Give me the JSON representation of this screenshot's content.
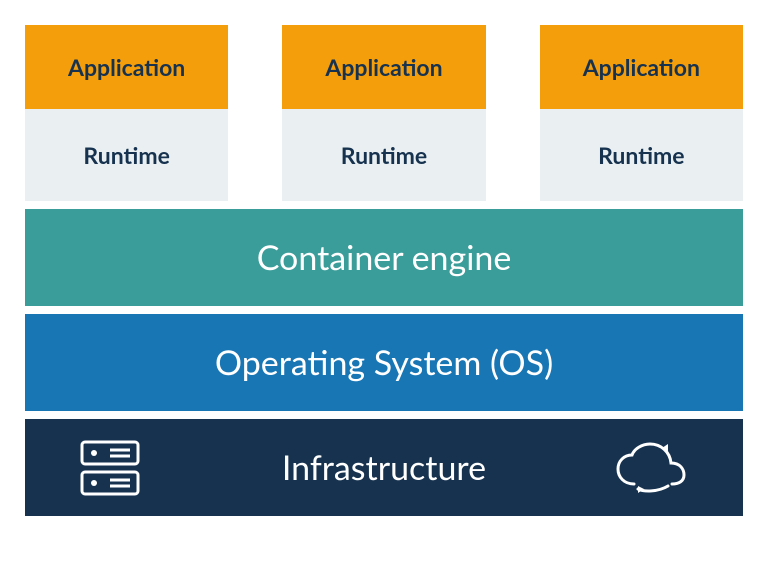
{
  "columns": [
    {
      "app": "Application",
      "runtime": "Runtime"
    },
    {
      "app": "Application",
      "runtime": "Runtime"
    },
    {
      "app": "Application",
      "runtime": "Runtime"
    }
  ],
  "layers": {
    "container_engine": "Container engine",
    "os": "Operating System (OS)",
    "infrastructure": "Infrastructure"
  },
  "colors": {
    "application": "#f59e0b",
    "runtime_bg": "#eaf0f2",
    "container_engine": "#3a9d9a",
    "os": "#1976b5",
    "infrastructure": "#16324f",
    "text_dark": "#16324f",
    "text_light": "#ffffff"
  }
}
